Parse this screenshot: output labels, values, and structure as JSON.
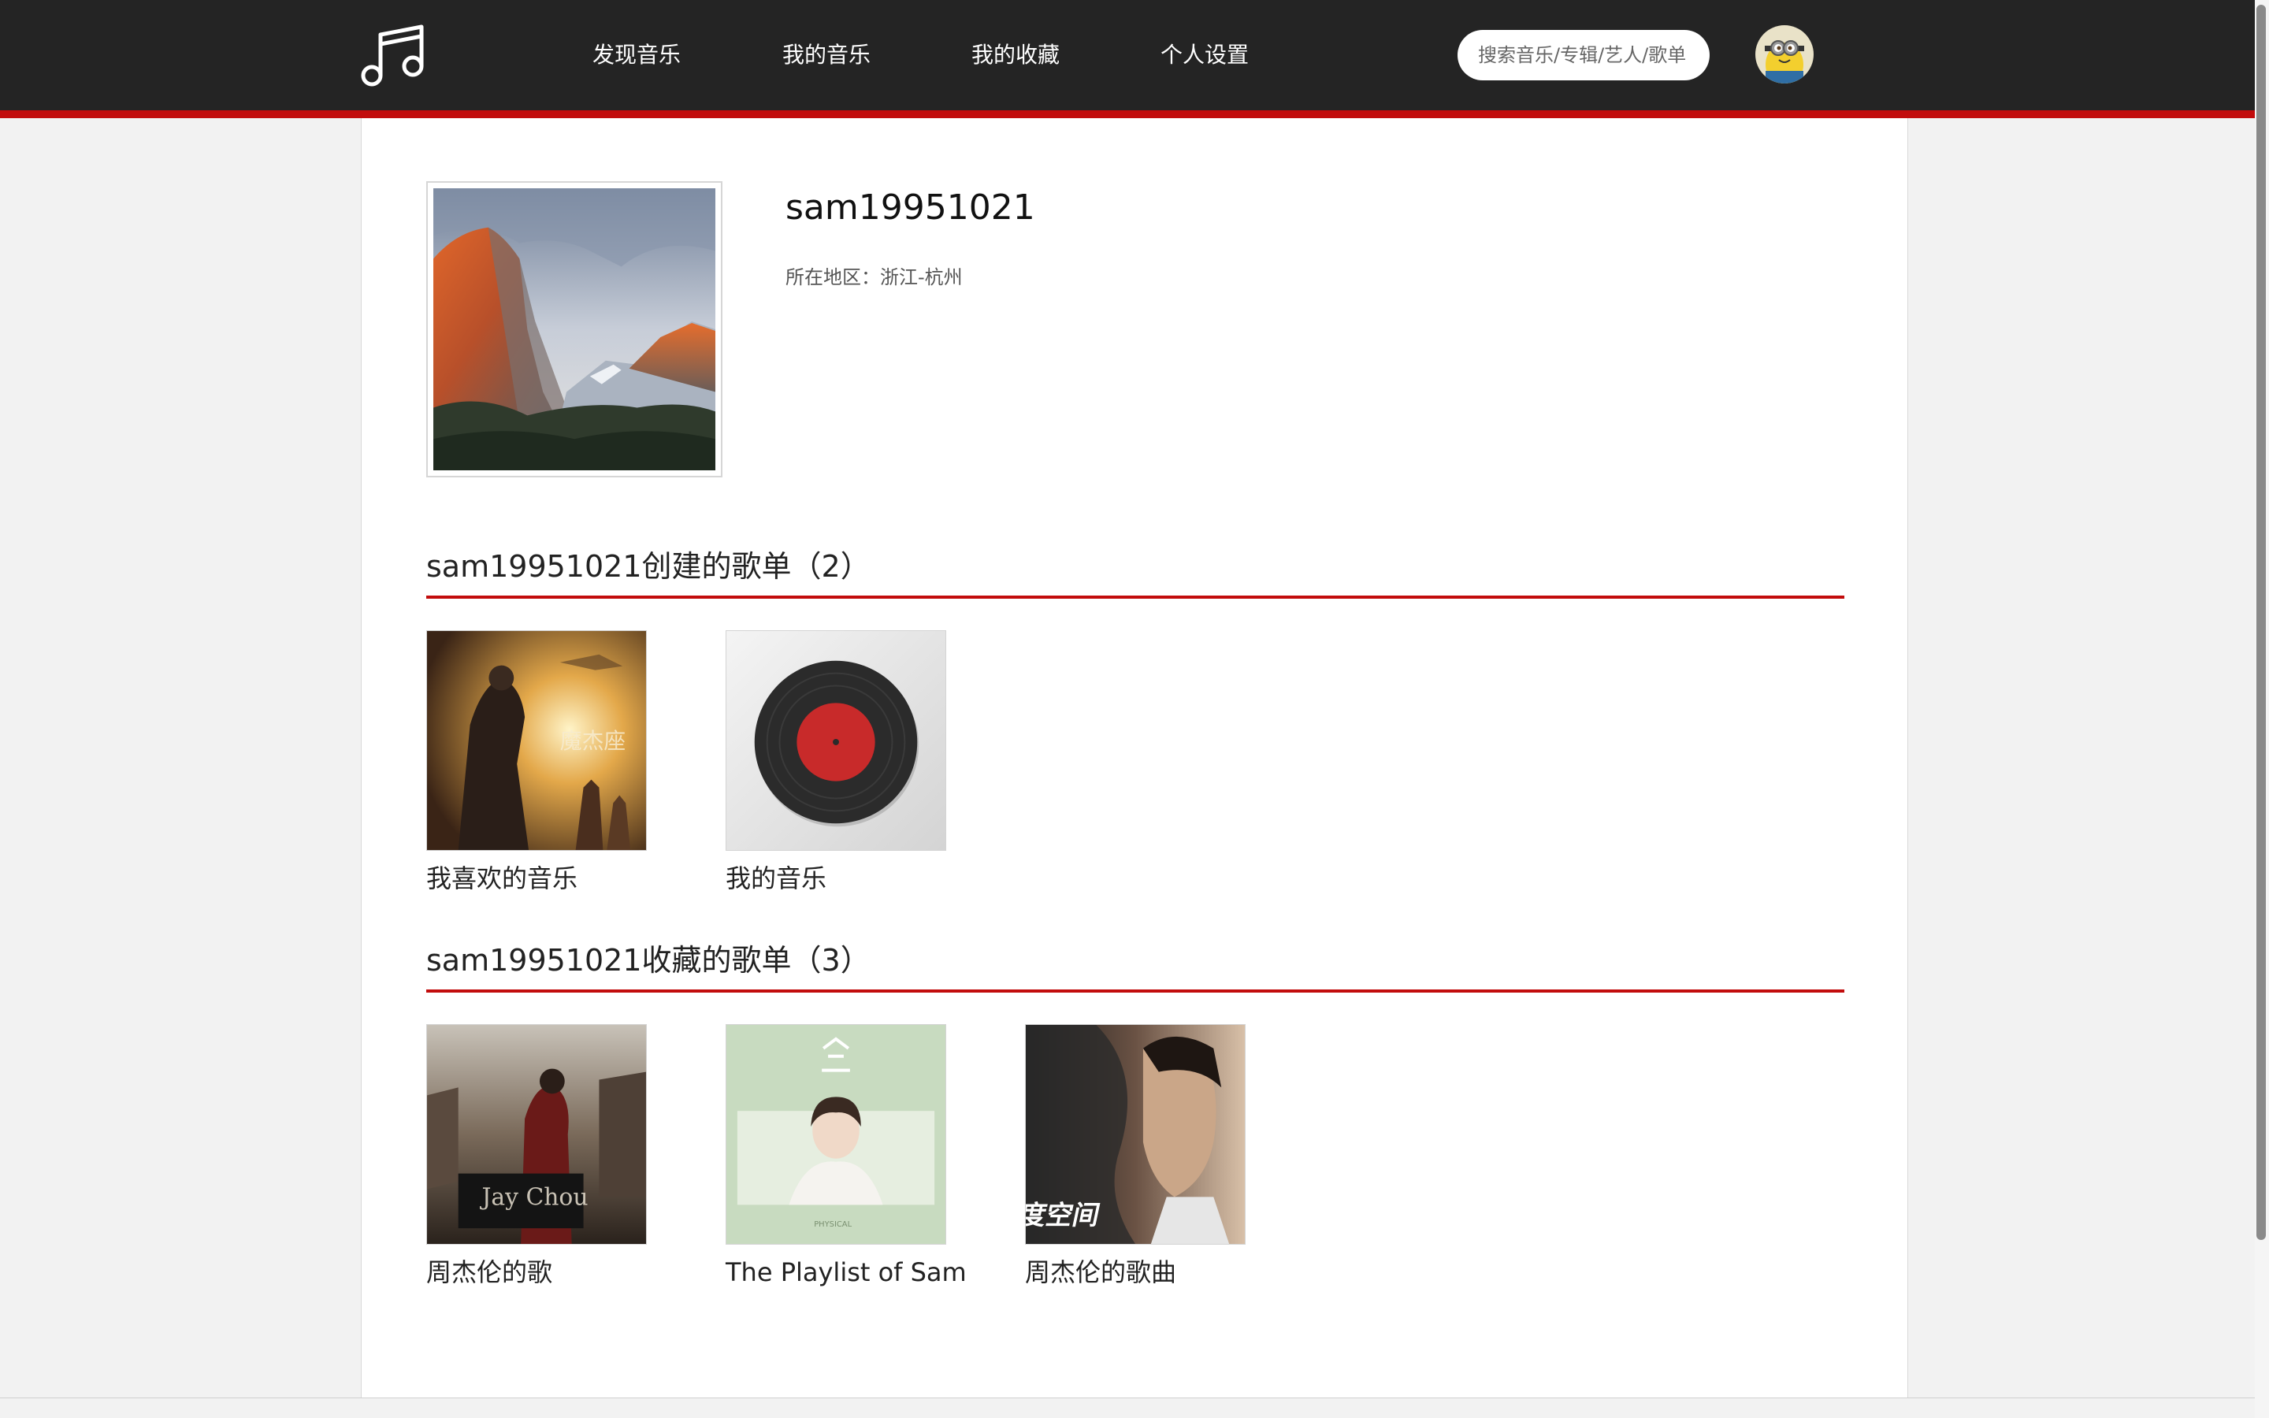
{
  "nav": {
    "items": [
      {
        "label": "发现音乐"
      },
      {
        "label": "我的音乐"
      },
      {
        "label": "我的收藏"
      },
      {
        "label": "个人设置"
      }
    ],
    "search_placeholder": "搜索音乐/专辑/艺人/歌单"
  },
  "profile": {
    "username": "sam19951021",
    "location": "所在地区：浙江-杭州"
  },
  "created_section": {
    "title": "sam19951021创建的歌单（2）",
    "playlists": [
      {
        "title": "我喜欢的音乐"
      },
      {
        "title": "我的音乐"
      }
    ]
  },
  "collected_section": {
    "title": "sam19951021收藏的歌单（3）",
    "playlists": [
      {
        "title": "周杰伦的歌"
      },
      {
        "title": "The Playlist of Sam"
      },
      {
        "title": "周杰伦的歌曲"
      }
    ]
  },
  "theme": {
    "accent": "#c20c0c",
    "nav_bg": "#242424",
    "page_bg": "#f2f2f2"
  },
  "icons": {
    "logo": "music-note-icon",
    "avatar": "minion-avatar-icon",
    "vinyl": "vinyl-record-icon"
  }
}
